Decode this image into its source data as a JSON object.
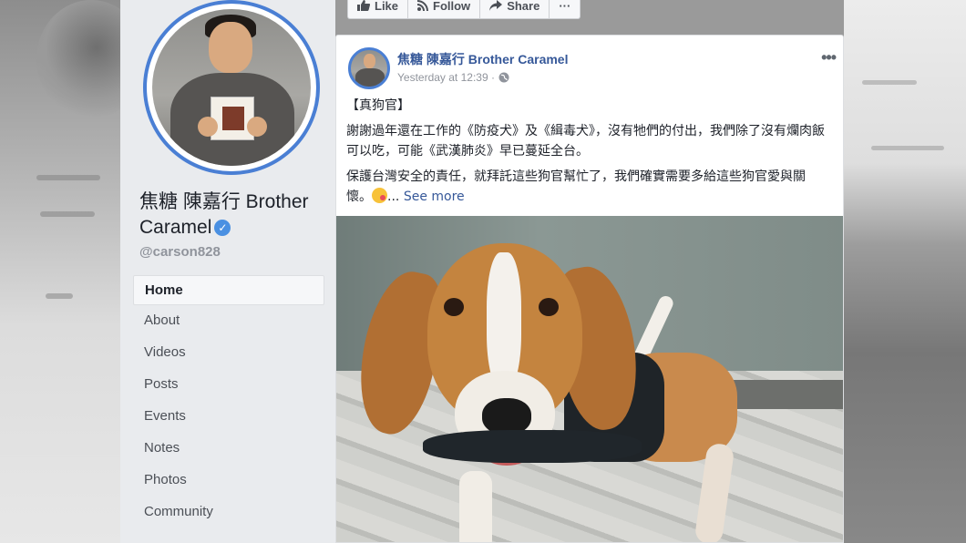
{
  "page": {
    "name": "焦糖 陳嘉行 Brother Caramel",
    "handle": "@carson828",
    "verified": true
  },
  "actions": {
    "like": "Like",
    "follow": "Follow",
    "share": "Share",
    "more": "···"
  },
  "nav": {
    "items": [
      {
        "label": "Home",
        "active": true
      },
      {
        "label": "About"
      },
      {
        "label": "Videos"
      },
      {
        "label": "Posts"
      },
      {
        "label": "Events"
      },
      {
        "label": "Notes"
      },
      {
        "label": "Photos"
      },
      {
        "label": "Community"
      }
    ]
  },
  "post": {
    "author": "焦糖 陳嘉行 Brother Caramel",
    "timestamp": "Yesterday at 12:39 · ",
    "privacy_icon": "globe-icon",
    "more": "•••",
    "title": "【真狗官】",
    "paragraph1": "謝謝過年還在工作的《防疫犬》及《緝毒犬》，沒有牠們的付出，我們除了沒有爛肉飯可以吃，可能《武漢肺炎》早已蔓延全台。",
    "paragraph2": "保護台灣安全的責任，就拜託這些狗官幫忙了，我們確實需要多給這些狗官愛與關懷。",
    "ellipsis": "... ",
    "see_more": "See more",
    "emoji": "winking-face-kiss-emoji"
  },
  "colors": {
    "accent": "#4a7fd4",
    "link": "#365899",
    "sidebar_bg": "#e9ebee"
  }
}
